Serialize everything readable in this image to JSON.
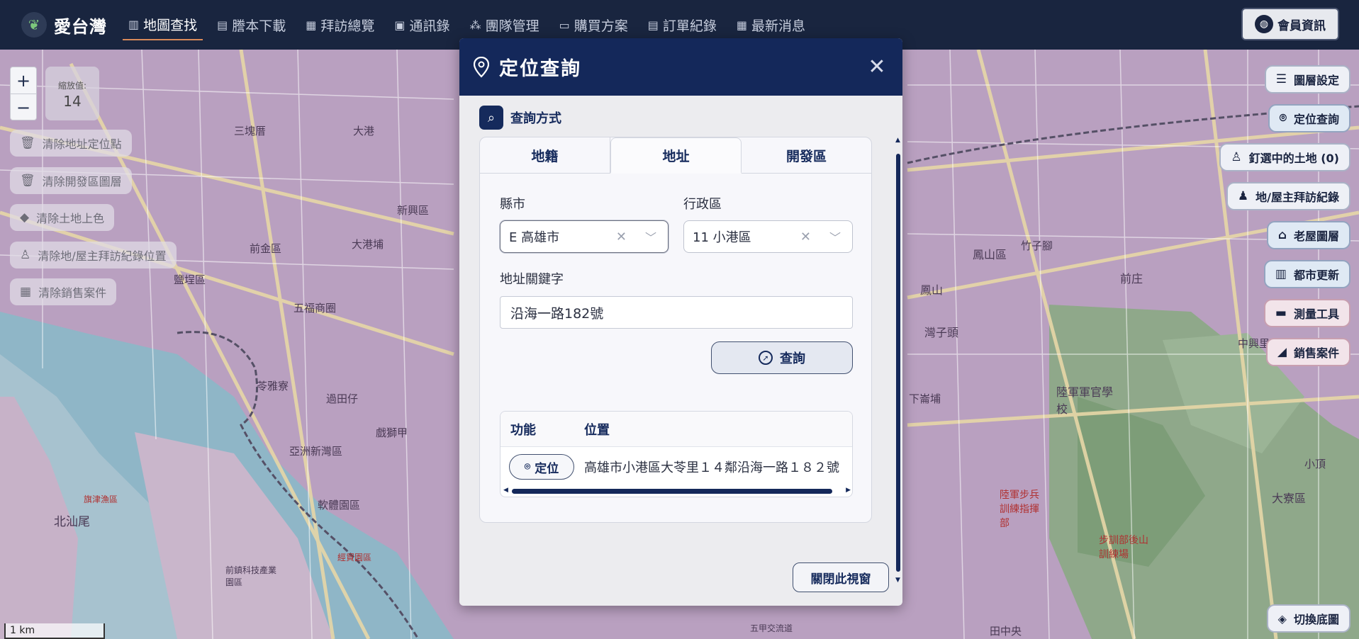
{
  "app": {
    "name": "愛台灣"
  },
  "nav": [
    {
      "label": "地圖查找",
      "icon": "map-icon"
    },
    {
      "label": "謄本下載",
      "icon": "document-icon"
    },
    {
      "label": "拜訪總覽",
      "icon": "chart-icon"
    },
    {
      "label": "通訊錄",
      "icon": "contact-card-icon"
    },
    {
      "label": "團隊管理",
      "icon": "team-icon"
    },
    {
      "label": "購買方案",
      "icon": "folder-icon"
    },
    {
      "label": "訂單紀錄",
      "icon": "receipt-icon"
    },
    {
      "label": "最新消息",
      "icon": "newspaper-icon"
    }
  ],
  "member_button": "會員資訊",
  "zoom": {
    "plus": "+",
    "minus": "−",
    "label": "縮放值:",
    "value": "14"
  },
  "left_buttons": [
    {
      "label": "清除地址定位點",
      "icon": "trash-icon"
    },
    {
      "label": "清除開發區圖層",
      "icon": "trash-icon"
    },
    {
      "label": "清除土地上色",
      "icon": "eraser-icon"
    },
    {
      "label": "清除地/屋主拜訪紀錄位置",
      "icon": "user-remove-icon"
    },
    {
      "label": "清除銷售案件",
      "icon": "list-icon"
    }
  ],
  "right_buttons": [
    {
      "label": "圖層設定",
      "icon": "sliders-icon"
    },
    {
      "label": "定位查詢",
      "icon": "pin-icon"
    },
    {
      "label": "釘選中的土地 (0)",
      "icon": "user-icon"
    },
    {
      "label": "地/屋主拜訪紀錄",
      "icon": "user-list-icon"
    },
    {
      "label": "老屋圖層",
      "icon": "house-icon"
    },
    {
      "label": "都市更新",
      "icon": "building-icon"
    },
    {
      "label": "測量工具",
      "icon": "ruler-icon"
    },
    {
      "label": "銷售案件",
      "icon": "megaphone-icon"
    }
  ],
  "basemap_button": "切換底圖",
  "scale_label": "1 km",
  "map_labels": [
    "三塊厝",
    "大港",
    "新興區",
    "前金區",
    "大港埔",
    "鹽埕區",
    "五福商圈",
    "苓雅寮",
    "過田仔",
    "戲獅甲",
    "亞洲新灣區",
    "軟體園區",
    "北汕尾",
    "前鎮科技產業園區",
    "旗津漁區",
    "經貿園區",
    "鳳山區",
    "鳳山",
    "前庄",
    "灣子頭",
    "陸軍軍官學校",
    "陸軍步兵訓練指揮部",
    "步訓部後山訓練場",
    "大寮區",
    "五甲交流道",
    "田中央",
    "下崙埔",
    "竹子腳",
    "中興里",
    "小頂"
  ],
  "modal": {
    "title": "定位查詢",
    "section_title": "查詢方式",
    "tabs": [
      "地籍",
      "地址",
      "開發區"
    ],
    "active_tab": "地址",
    "city_label": "縣市",
    "city_value": "E 高雄市",
    "district_label": "行政區",
    "district_value": "11 小港區",
    "keyword_label": "地址關鍵字",
    "keyword_value": "沿海一路182號",
    "query_button": "查詢",
    "table": {
      "headers": [
        "功能",
        "位置"
      ],
      "rows": [
        {
          "action": "定位",
          "location": "高雄市小港區大苓里１４鄰沿海一路１８２號"
        }
      ]
    },
    "close_window": "關閉此視窗"
  },
  "colors": {
    "nav_bg": "#19253f",
    "modal_header": "#14285a",
    "accent": "#d98a5a"
  }
}
